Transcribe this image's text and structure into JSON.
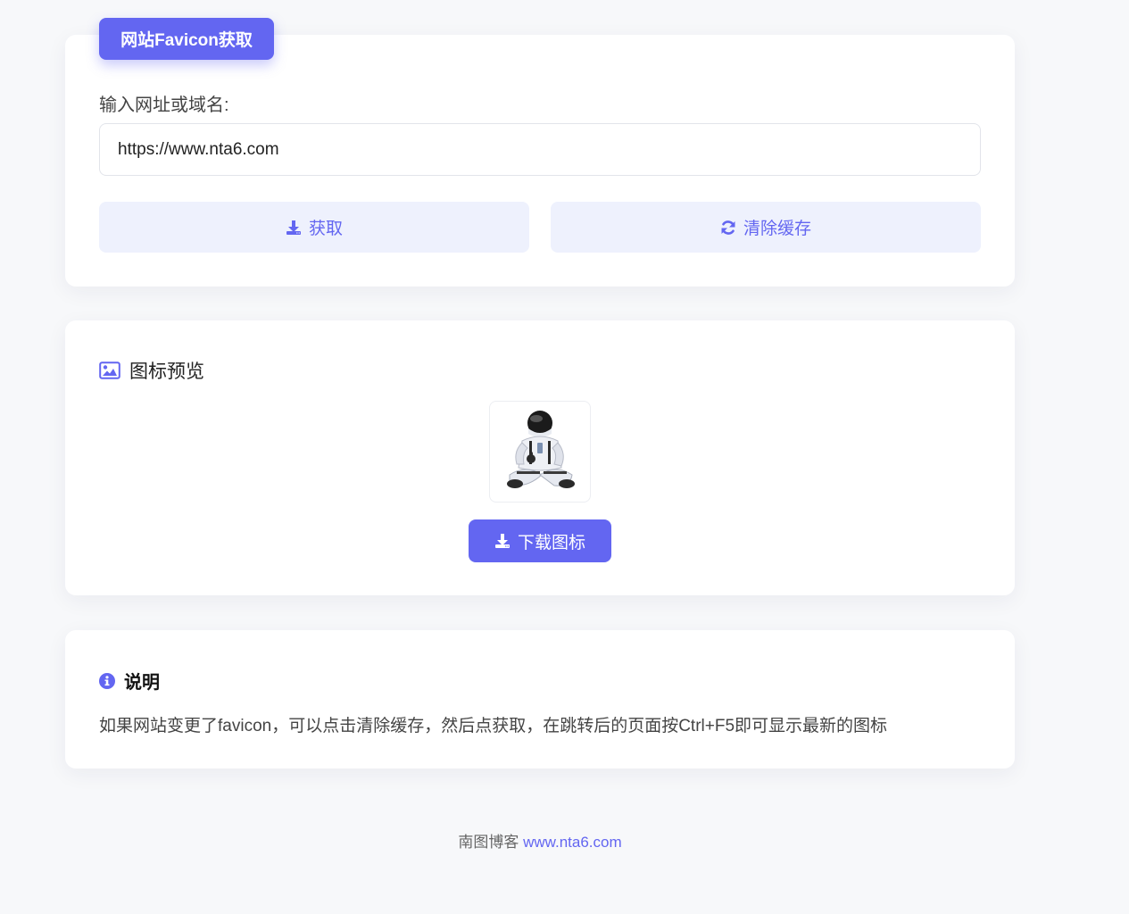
{
  "app": {
    "title": "网站Favicon获取"
  },
  "fetch_form": {
    "label": "输入网址或域名:",
    "input_value": "https://www.nta6.com",
    "fetch_label": "获取",
    "clear_label": "清除缓存"
  },
  "preview": {
    "heading": "图标预览",
    "download_label": "下载图标",
    "image_icon": "image-icon"
  },
  "info": {
    "heading": "说明",
    "text": "如果网站变更了favicon，可以点击清除缓存，然后点获取，在跳转后的页面按Ctrl+F5即可显示最新的图标"
  },
  "footer": {
    "text": "南图博客",
    "link": "www.nta6.com"
  },
  "colors": {
    "accent": "#6366f1",
    "accent_soft": "#eef1fd",
    "background": "#f7f8fa"
  }
}
